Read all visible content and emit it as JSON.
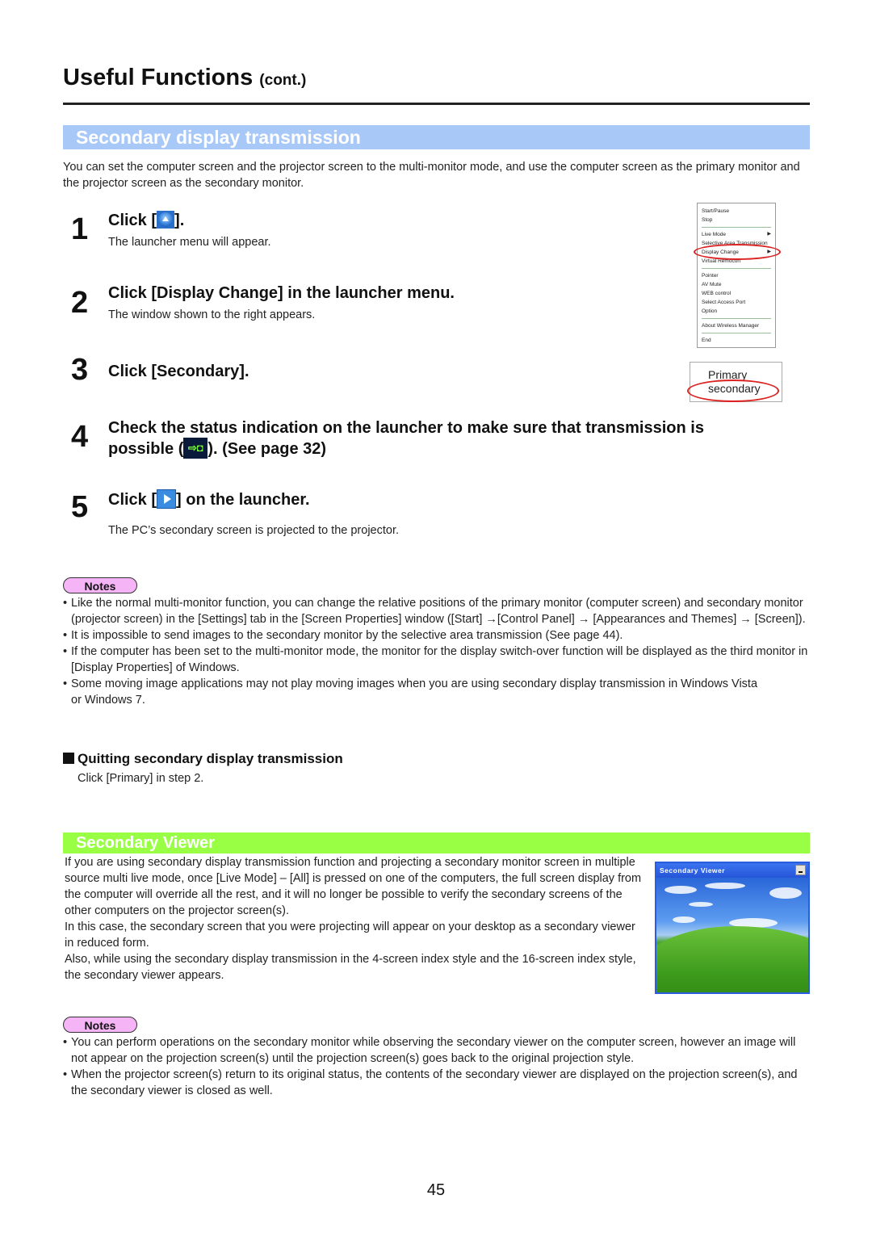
{
  "header": {
    "title": "Useful Functions",
    "title_suffix": "(cont.)"
  },
  "section1": {
    "title": "Secondary display transmission",
    "intro": "You can set the computer screen and the projector screen to the multi-monitor mode, and use the computer screen as the primary monitor and the projector screen as the secondary monitor.",
    "steps": [
      {
        "num": "1",
        "title_pre": "Click [",
        "icon": "launcher-up-icon",
        "title_post": "].",
        "desc": "The launcher menu will appear."
      },
      {
        "num": "2",
        "title": "Click [Display Change] in the launcher menu.",
        "desc": "The window shown to the right appears."
      },
      {
        "num": "3",
        "title": "Click [Secondary]."
      },
      {
        "num": "4",
        "title_line1": "Check the status indication on the launcher to make sure that transmission is",
        "title_pre": "possible (",
        "icon": "transmission-possible-icon",
        "title_post": "). (See page 32)"
      },
      {
        "num": "5",
        "title_pre": "Click [",
        "icon": "play-icon",
        "title_post": "] on the launcher.",
        "desc": "The PC’s secondary screen is projected to the projector."
      }
    ],
    "launcher_menu": {
      "items": [
        "Start/Pause",
        "Stop",
        "Live Mode",
        "Selective Area Transmission",
        "Display Change",
        "Virtual Remocon",
        "Pointer",
        "AV Mute",
        "WEB control",
        "Select Access Port",
        "Option",
        "About Wireless Manager",
        "End"
      ],
      "highlighted": "Display Change"
    },
    "display_popup": {
      "options": [
        "Primary",
        "secondary"
      ],
      "highlighted": "secondary"
    },
    "notes_label": "Notes",
    "notes": [
      "Like the normal multi-monitor function, you can change the relative positions of the primary monitor (computer screen) and secondary monitor (projector screen) in the [Settings] tab in the [Screen Properties] window ([Start] →[Control Panel] → [Appearances and Themes] → [Screen]).",
      "It is impossible to send images to the secondary monitor by the selective area transmission (See page 44).",
      "If the computer has been set to the multi-monitor mode, the monitor for the display switch-over function will be displayed as the third monitor in [Display Properties] of Windows.",
      "Some moving image applications may not play moving images when you are using secondary display transmission in Windows Vista or Windows 7."
    ],
    "quit_title": "Quitting secondary display transmission",
    "quit_desc": "Click [Primary] in step 2."
  },
  "section2": {
    "title": "Secondary Viewer",
    "paragraphs": [
      "If you are using secondary display transmission function and projecting a secondary monitor screen in multiple source multi live mode, once [Live Mode] – [All] is pressed on one of the computers, the full screen display from the computer will override all the rest, and it will no longer be possible to verify the secondary screens of the other computers on the projector screen(s).",
      "In this case, the secondary screen that you were projecting will appear on your desktop as a secondary viewer in reduced form.",
      "Also, while using the secondary display transmission in the 4-screen index style and the 16-screen index style, the secondary viewer appears."
    ],
    "viewer_window_title": "Secondary Viewer",
    "notes_label": "Notes",
    "notes": [
      "You can perform operations on the secondary monitor while observing the secondary viewer on the computer screen, however an image will not appear on the projection screen(s) until the projection screen(s) goes back to the original projection style.",
      "When the projector screen(s) return to its original status, the contents of the secondary viewer are displayed on the projection screen(s), and the secondary viewer is closed as well."
    ]
  },
  "page_number": "45",
  "colors": {
    "section1_band": "#a8c8f8",
    "section2_band": "#99ff44",
    "notes_badge": "#f5b4f5",
    "highlight_ring": "#dd2222"
  }
}
